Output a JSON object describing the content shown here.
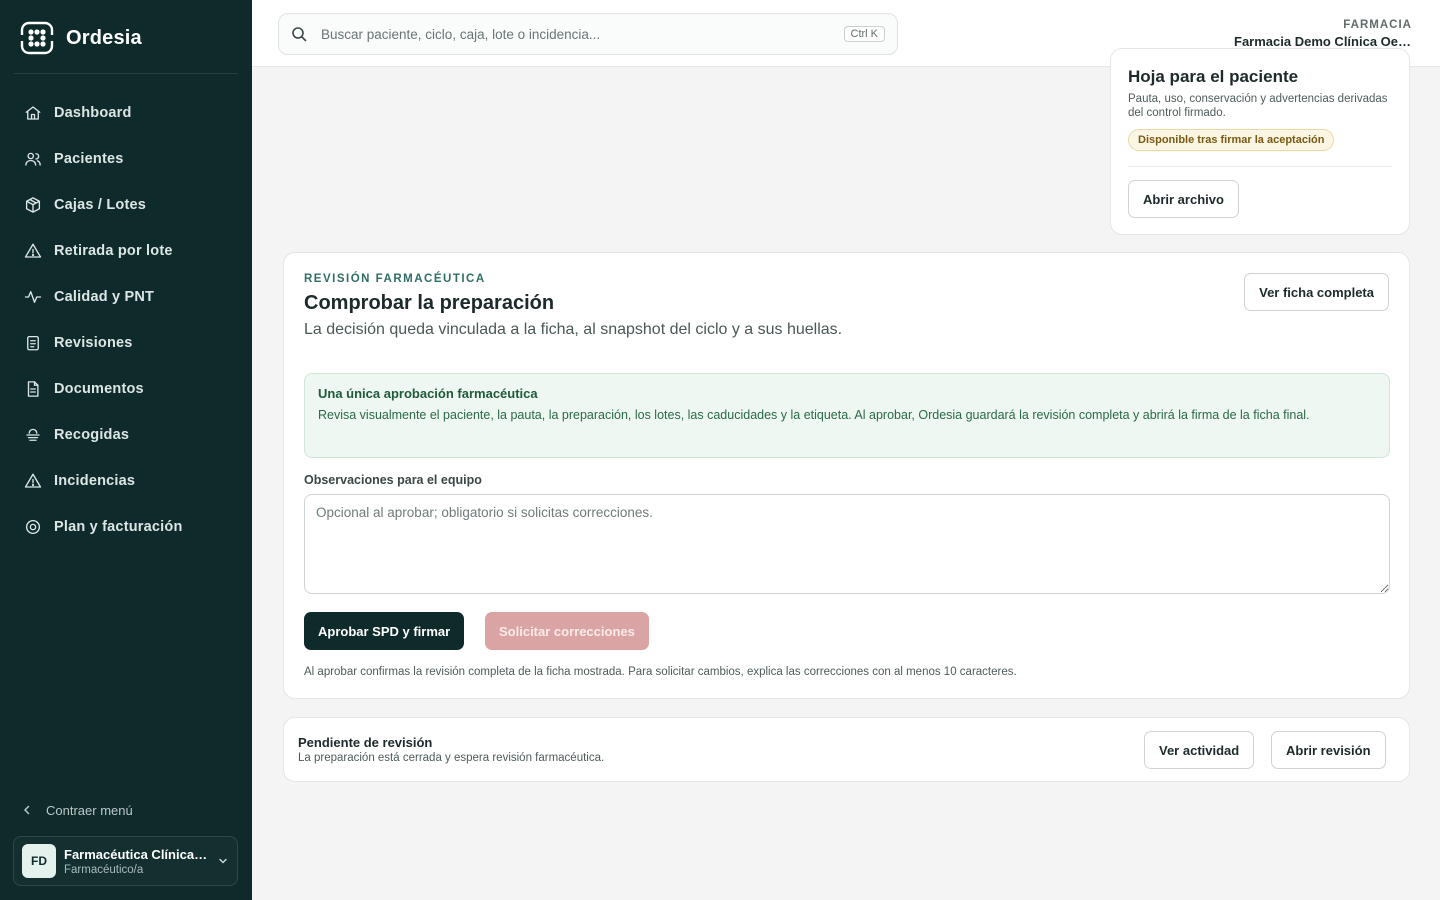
{
  "brand": {
    "name": "Ordesia"
  },
  "sidebar": {
    "items": [
      {
        "label": "Dashboard",
        "icon": "home-icon"
      },
      {
        "label": "Pacientes",
        "icon": "users-icon"
      },
      {
        "label": "Cajas / Lotes",
        "icon": "box-icon"
      },
      {
        "label": "Retirada por lote",
        "icon": "warning-icon"
      },
      {
        "label": "Calidad y PNT",
        "icon": "activity-icon"
      },
      {
        "label": "Revisiones",
        "icon": "clipboard-icon"
      },
      {
        "label": "Documentos",
        "icon": "document-icon"
      },
      {
        "label": "Recogidas",
        "icon": "pickup-icon"
      },
      {
        "label": "Incidencias",
        "icon": "alert-icon"
      },
      {
        "label": "Plan y facturación",
        "icon": "settings-icon"
      }
    ],
    "collapse_label": "Contraer menú",
    "user": {
      "initials": "FD",
      "name": "Farmacéutica Clínica Demo",
      "role": "Farmacéutico/a"
    }
  },
  "topbar": {
    "search_placeholder": "Buscar paciente, ciclo, caja, lote o incidencia...",
    "shortcut": "Ctrl K",
    "pharmacy_label": "FARMACIA",
    "pharmacy_name": "Farmacia Demo Clínica Oeste"
  },
  "patient_sheet": {
    "title": "Hoja para el paciente",
    "description": "Pauta, uso, conservación y advertencias derivadas del control firmado.",
    "badge": "Disponible tras firmar la aceptación",
    "open_button": "Abrir archivo"
  },
  "review": {
    "eyebrow": "REVISIÓN FARMACÉUTICA",
    "title": "Comprobar la preparación",
    "subtitle": "La decisión queda vinculada a la ficha, al snapshot del ciclo y a sus huellas.",
    "full_button": "Ver ficha completa",
    "info_title": "Una única aprobación farmacéutica",
    "info_text": "Revisa visualmente el paciente, la pauta, la preparación, los lotes, las caducidades y la etiqueta. Al aprobar, Ordesia guardará la revisión completa y abrirá la firma de la ficha final.",
    "obs_label": "Observaciones para el equipo",
    "obs_placeholder": "Opcional al aprobar; obligatorio si solicitas correcciones.",
    "approve_button": "Aprobar SPD y firmar",
    "corrections_button": "Solicitar correcciones",
    "note": "Al aprobar confirmas la revisión completa de la ficha mostrada. Para solicitar cambios, explica las correcciones con al menos 10 caracteres."
  },
  "pending": {
    "title": "Pendiente de revisión",
    "description": "La preparación está cerrada y espera revisión farmacéutica.",
    "activity_button": "Ver actividad",
    "open_button": "Abrir revisión"
  },
  "colors": {
    "sidebar_bg": "#0f2a2b",
    "accent_teal": "#2f6e66",
    "info_bg": "#eef7f1",
    "danger_disabled": "#dba4a4"
  }
}
